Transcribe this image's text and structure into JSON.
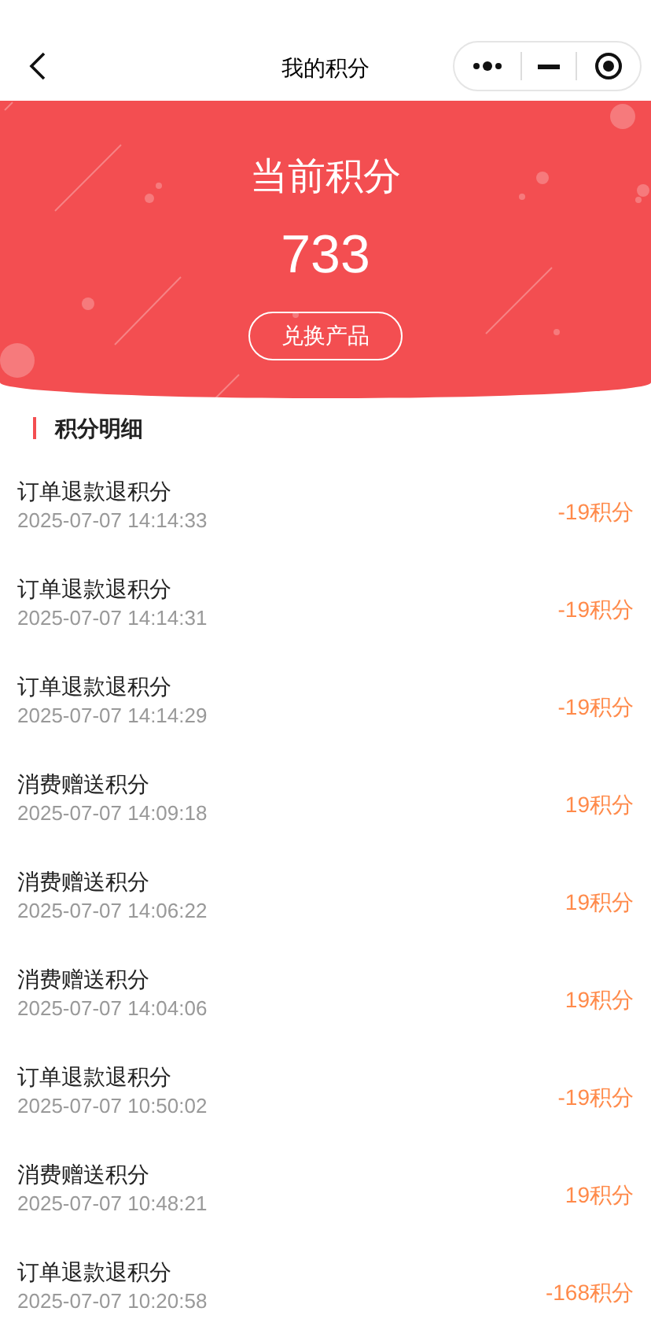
{
  "nav": {
    "title": "我的积分"
  },
  "summary": {
    "label": "当前积分",
    "points": "733",
    "button": "兑换产品"
  },
  "section": {
    "title": "积分明细"
  },
  "records": [
    {
      "title": "订单退款退积分",
      "time": "2025-07-07 14:14:33",
      "amount": "-19积分"
    },
    {
      "title": "订单退款退积分",
      "time": "2025-07-07 14:14:31",
      "amount": "-19积分"
    },
    {
      "title": "订单退款退积分",
      "time": "2025-07-07 14:14:29",
      "amount": "-19积分"
    },
    {
      "title": "消费赠送积分",
      "time": "2025-07-07 14:09:18",
      "amount": "19积分"
    },
    {
      "title": "消费赠送积分",
      "time": "2025-07-07 14:06:22",
      "amount": "19积分"
    },
    {
      "title": "消费赠送积分",
      "time": "2025-07-07 14:04:06",
      "amount": "19积分"
    },
    {
      "title": "订单退款退积分",
      "time": "2025-07-07 10:50:02",
      "amount": "-19积分"
    },
    {
      "title": "消费赠送积分",
      "time": "2025-07-07 10:48:21",
      "amount": "19积分"
    },
    {
      "title": "订单退款退积分",
      "time": "2025-07-07 10:20:58",
      "amount": "-168积分"
    }
  ]
}
